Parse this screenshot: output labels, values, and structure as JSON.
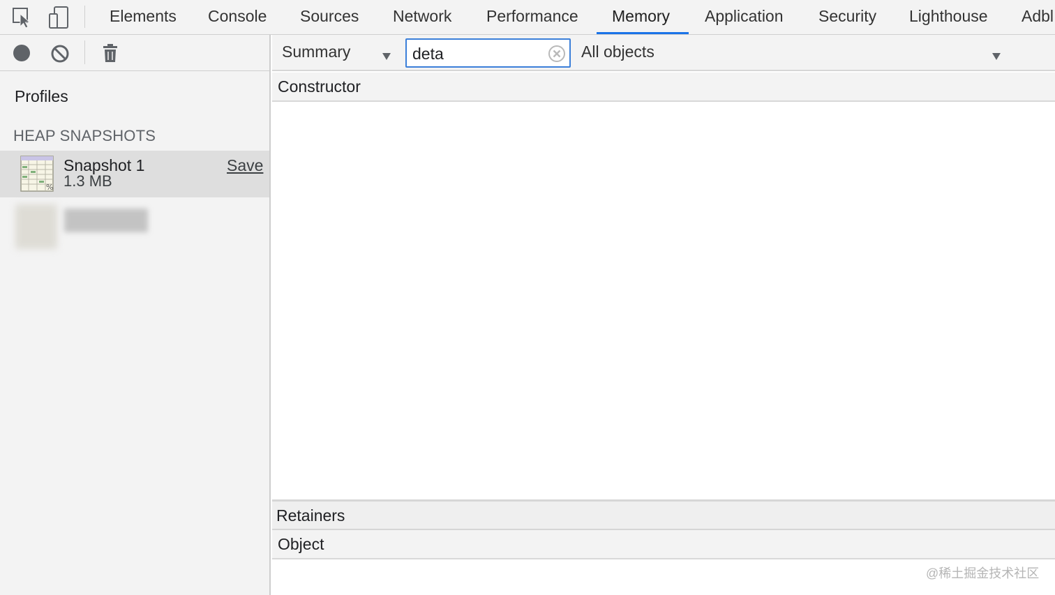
{
  "tabs": [
    {
      "label": "Elements"
    },
    {
      "label": "Console"
    },
    {
      "label": "Sources"
    },
    {
      "label": "Network"
    },
    {
      "label": "Performance"
    },
    {
      "label": "Memory",
      "active": true
    },
    {
      "label": "Application"
    },
    {
      "label": "Security"
    },
    {
      "label": "Lighthouse"
    },
    {
      "label": "Adbl"
    }
  ],
  "toolbar_icons": [
    "inspect-element-icon",
    "device-toggle-icon"
  ],
  "sidebar": {
    "toolbar_icons": [
      "record-icon",
      "clear-all-icon",
      "garbage-collect-icon"
    ],
    "profiles_label": "Profiles",
    "section_label": "HEAP SNAPSHOTS",
    "snapshot": {
      "name": "Snapshot 1",
      "size": "1.3 MB",
      "save_label": "Save"
    }
  },
  "filterbar": {
    "view_select": "Summary",
    "filter_value": "deta",
    "objects_select": "All objects"
  },
  "grid": {
    "constructor_header": "Constructor",
    "retainers_header": "Retainers",
    "object_header": "Object"
  },
  "watermark": "@稀土掘金技术社区",
  "colors": {
    "accent": "#1a73e8",
    "panel_bg": "#f3f3f3",
    "selected_row": "#dedede"
  }
}
